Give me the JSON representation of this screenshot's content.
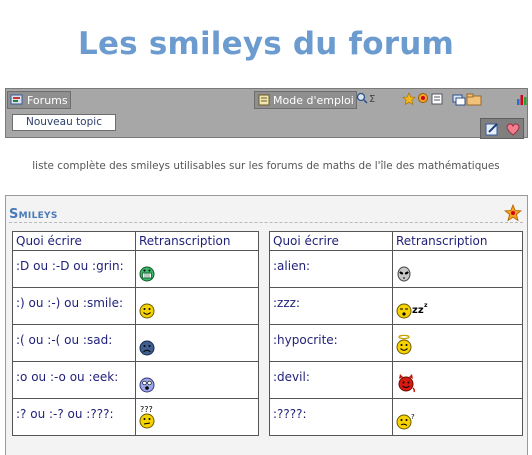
{
  "page": {
    "title": "Les smileys du forum",
    "description": "liste complète des smileys utilisables sur les forums de maths de l'île des mathématiques"
  },
  "toolbar": {
    "forums_label": "Forums",
    "mode_label": "Mode d'emploi",
    "new_topic_label": "Nouveau topic"
  },
  "panel": {
    "title": "Smileys"
  },
  "table_headers": {
    "code": "Quoi écrire",
    "render": "Retranscription"
  },
  "left_rows": [
    {
      "code": ":D ou :-D ou :grin:",
      "smiley": "grin"
    },
    {
      "code": ":) ou :-) ou :smile:",
      "smiley": "smile"
    },
    {
      "code": ":( ou :-( ou :sad:",
      "smiley": "sad"
    },
    {
      "code": ":o ou :-o ou :eek:",
      "smiley": "eek"
    },
    {
      "code": ":? ou :-? ou :???:",
      "smiley": "confused"
    }
  ],
  "right_rows": [
    {
      "code": ":alien:",
      "smiley": "alien"
    },
    {
      "code": ":zzz:",
      "smiley": "zzz"
    },
    {
      "code": ":hypocrite:",
      "smiley": "hypocrite"
    },
    {
      "code": ":devil:",
      "smiley": "devil"
    },
    {
      "code": ":????:",
      "smiley": "doubt"
    }
  ],
  "colors": {
    "title": "#6b9bcf",
    "toolbar_bg": "#a7a7a7",
    "link_text": "#1f1f7a"
  }
}
